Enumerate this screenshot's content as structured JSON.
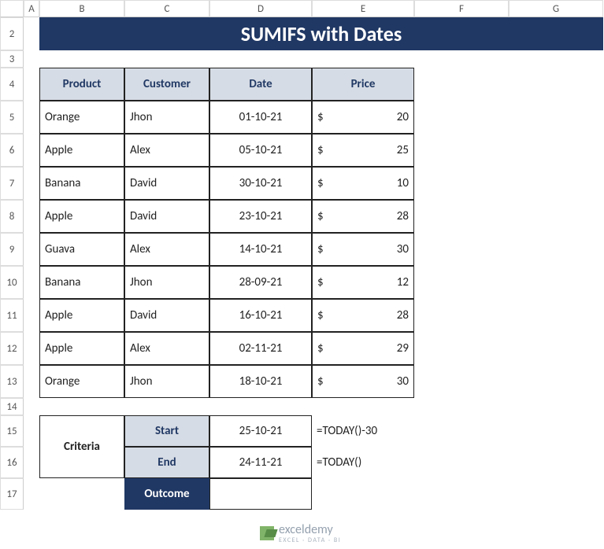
{
  "columns": [
    "A",
    "B",
    "C",
    "D",
    "E",
    "F",
    "G"
  ],
  "row_numbers": [
    2,
    3,
    4,
    5,
    6,
    7,
    8,
    9,
    10,
    11,
    12,
    13,
    14,
    15,
    16,
    17
  ],
  "title": "SUMIFS with Dates",
  "headers": {
    "product": "Product",
    "customer": "Customer",
    "date": "Date",
    "price": "Price"
  },
  "rows": [
    {
      "product": "Orange",
      "customer": "Jhon",
      "date": "01-10-21",
      "currency": "$",
      "price": "20"
    },
    {
      "product": "Apple",
      "customer": "Alex",
      "date": "05-10-21",
      "currency": "$",
      "price": "25"
    },
    {
      "product": "Banana",
      "customer": "David",
      "date": "30-10-21",
      "currency": "$",
      "price": "10"
    },
    {
      "product": "Apple",
      "customer": "David",
      "date": "23-10-21",
      "currency": "$",
      "price": "28"
    },
    {
      "product": "Guava",
      "customer": "Alex",
      "date": "14-10-21",
      "currency": "$",
      "price": "30"
    },
    {
      "product": "Banana",
      "customer": "Jhon",
      "date": "28-09-21",
      "currency": "$",
      "price": "12"
    },
    {
      "product": "Apple",
      "customer": "David",
      "date": "16-10-21",
      "currency": "$",
      "price": "28"
    },
    {
      "product": "Apple",
      "customer": "Alex",
      "date": "02-11-21",
      "currency": "$",
      "price": "29"
    },
    {
      "product": "Orange",
      "customer": "Jhon",
      "date": "18-10-21",
      "currency": "$",
      "price": "30"
    }
  ],
  "criteria": {
    "label": "Criteria",
    "start_label": "Start",
    "start_value": "25-10-21",
    "start_formula": "=TODAY()-30",
    "end_label": "End",
    "end_value": "24-11-21",
    "end_formula": "=TODAY()",
    "outcome_label": "Outcome"
  },
  "watermark": {
    "brand": "exceldemy",
    "sub": "EXCEL · DATA · BI"
  }
}
